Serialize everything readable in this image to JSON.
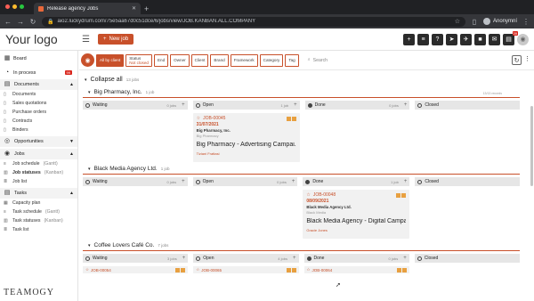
{
  "browser": {
    "tab_title": "Release agency Jobs",
    "url": "aio2.luckydrum.com/75e5aa67d0c51dce/6/jobs/view/JOB.KANBAN.ALL.COMPANY",
    "profile": "Anonymní",
    "colors": {
      "close": "#ff5f57",
      "min": "#febc2e",
      "max": "#28c840"
    }
  },
  "header": {
    "logo": "Your logo",
    "new_job": "New job",
    "notification_badge": "39"
  },
  "sidebar": {
    "board": "Board",
    "in_process": "In process",
    "in_process_badge": "99",
    "documents": "Documents",
    "documents_items": [
      "Documents",
      "Sales quotations",
      "Purchase orders",
      "Contracts",
      "Binders"
    ],
    "opportunities": "Opportunities",
    "jobs": "Jobs",
    "job_schedule": "Job schedule",
    "job_schedule_hint": "(Gantt)",
    "job_statuses": "Job statuses",
    "job_statuses_hint": "(Kanban)",
    "job_list": "Job list",
    "tasks": "Tasks",
    "capacity_plan": "Capacity plan",
    "task_schedule": "Task schedule",
    "task_schedule_hint": "(Gantt)",
    "task_statuses": "Task statuses",
    "task_statuses_hint": "(Kanban)",
    "task_list": "Task list",
    "footer_logo": "TEAMOGY"
  },
  "filters": {
    "all_by_client": "All by client",
    "status_label": "Status",
    "status_value": "Not closed",
    "chips": [
      "End",
      "Owner",
      "Client",
      "Brand",
      "Framework",
      "Category",
      "Tag"
    ],
    "search_placeholder": "Search",
    "meta": "13/13 records"
  },
  "board": {
    "collapse_label": "Collapse all",
    "collapse_count": "13 jobs",
    "column_labels": [
      "Waiting",
      "Open",
      "Done",
      "Closed"
    ],
    "groups": [
      {
        "name": "Big Pharmacy, Inc.",
        "count": "1 job",
        "col_counts": [
          "0 jobs",
          "1 job",
          "0 jobs",
          ""
        ],
        "card": {
          "id": "JOB-00045",
          "date": "31/07/2021",
          "client": "Big Pharmacy, Inc.",
          "brand": "Big Pharmacy",
          "name": "Big Pharmacy - Advertising Campai...",
          "owner": "Tiziani Frattasi"
        }
      },
      {
        "name": "Black Media Agency Ltd.",
        "count": "1 job",
        "col_counts": [
          "0 jobs",
          "0 jobs",
          "1 job",
          ""
        ],
        "card": {
          "id": "JOB-00048",
          "date": "08/09/2021",
          "client": "Black Media Agency Ltd.",
          "brand": "Black Media",
          "name": "Black Media Agency - Digital Campa...",
          "owner": "Gracie Jones"
        }
      },
      {
        "name": "Coffee Lovers Café Co.",
        "count": "7 jobs",
        "col_counts": [
          "3 jobs",
          "4 jobs",
          "0 jobs",
          ""
        ],
        "mini": [
          "JOB-00054",
          "JOB-00065",
          "JOB-00064"
        ]
      }
    ]
  }
}
